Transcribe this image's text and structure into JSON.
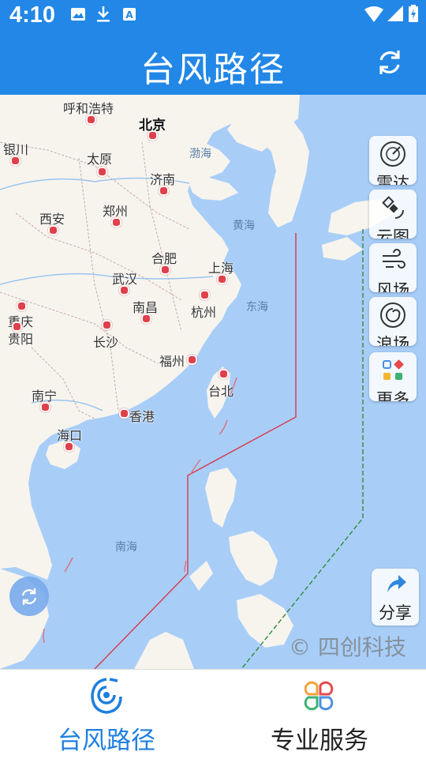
{
  "status_bar": {
    "time": "4:10",
    "icons": [
      "image-icon",
      "download-icon",
      "notification-a-icon",
      "wifi-icon",
      "signal-icon",
      "battery-charging-icon"
    ]
  },
  "app_bar": {
    "title": "台风路径",
    "refresh_icon": "refresh-icon"
  },
  "map": {
    "cities": [
      {
        "name": "呼和浩特"
      },
      {
        "name": "北京"
      },
      {
        "name": "银川"
      },
      {
        "name": "太原"
      },
      {
        "name": "济南"
      },
      {
        "name": "西安"
      },
      {
        "name": "郑州"
      },
      {
        "name": "合肥"
      },
      {
        "name": "上海"
      },
      {
        "name": "武汉"
      },
      {
        "name": "南昌"
      },
      {
        "name": "杭州"
      },
      {
        "name": "重庆"
      },
      {
        "name": "贵阳"
      },
      {
        "name": "长沙"
      },
      {
        "name": "福州"
      },
      {
        "name": "台北"
      },
      {
        "name": "南宁"
      },
      {
        "name": "香港"
      },
      {
        "name": "海口"
      }
    ],
    "seas": [
      {
        "name": "渤海"
      },
      {
        "name": "黄海"
      },
      {
        "name": "东海"
      },
      {
        "name": "南海"
      }
    ],
    "watermark": "© 四创科技"
  },
  "side_tools": [
    {
      "label": "雷达",
      "icon": "radar-icon"
    },
    {
      "label": "云图",
      "icon": "satellite-icon"
    },
    {
      "label": "风场",
      "icon": "wind-icon"
    },
    {
      "label": "浪场",
      "icon": "wave-icon"
    },
    {
      "label": "更多",
      "icon": "more-grid-icon"
    }
  ],
  "share": {
    "label": "分享",
    "icon": "share-icon"
  },
  "bottom_nav": [
    {
      "label": "台风路径",
      "icon": "typhoon-icon",
      "active": true
    },
    {
      "label": "专业服务",
      "icon": "clover-icon",
      "active": false
    }
  ],
  "colors": {
    "primary": "#2287e6",
    "active_nav": "#1f7fe0",
    "sea": "#a8cef8",
    "land": "#f7f4ee",
    "warning_line_red": "#d9384a",
    "warning_line_green": "#2e8b3a"
  }
}
